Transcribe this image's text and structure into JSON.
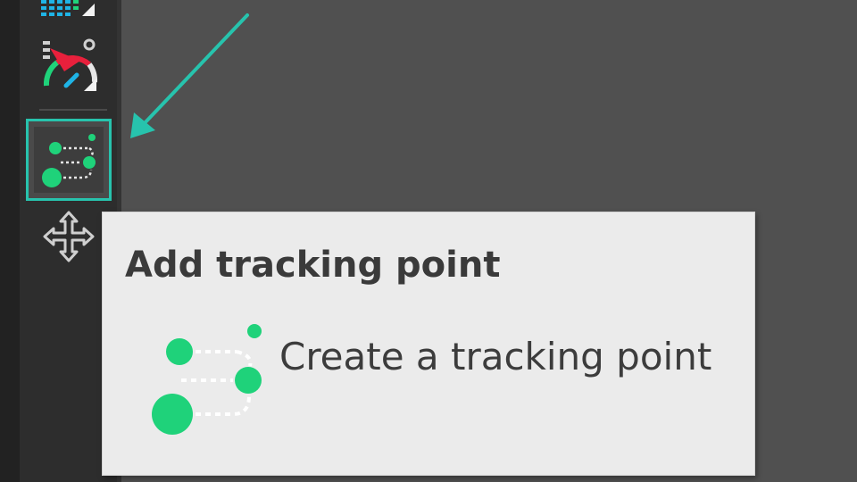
{
  "toolbar": {
    "tools": [
      {
        "name": "grid-chart-tool",
        "icon": "grid-chart-icon"
      },
      {
        "name": "speed-gauge-tool",
        "icon": "speedometer-icon"
      },
      {
        "name": "tracking-point-tool",
        "icon": "tracking-point-icon",
        "selected": true
      },
      {
        "name": "move-tool",
        "icon": "move-arrows-icon"
      }
    ]
  },
  "tooltip": {
    "title": "Add tracking point",
    "description": "Create a tracking point",
    "icon": "tracking-point-icon"
  },
  "colors": {
    "accent": "#27c3ad",
    "tracking_green": "#1fd27a",
    "gauge_red": "#e8203c",
    "gauge_blue": "#1fb4e6",
    "tooltip_bg": "#ebebeb",
    "workspace_bg": "#505050",
    "toolbar_bg": "#2d2d2d"
  }
}
